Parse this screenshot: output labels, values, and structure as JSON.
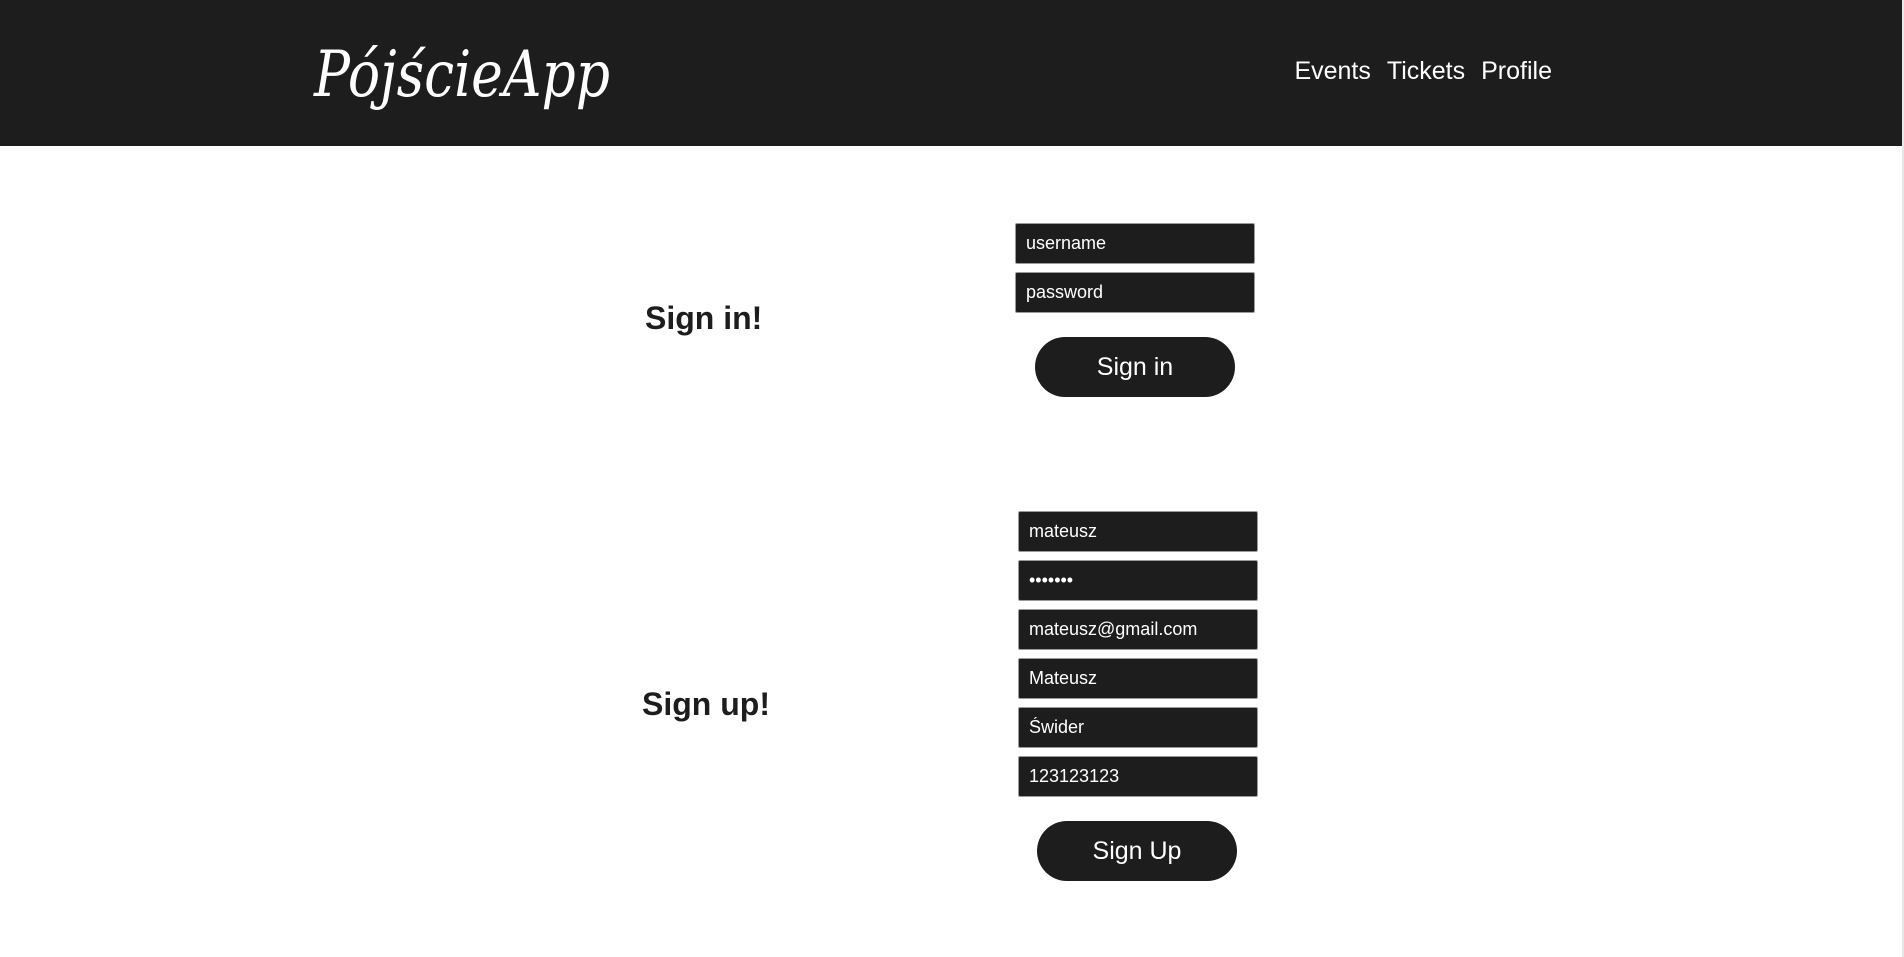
{
  "header": {
    "logo_text": "PójścieApp",
    "nav": [
      {
        "label": "Events"
      },
      {
        "label": "Tickets"
      },
      {
        "label": "Profile"
      }
    ]
  },
  "signin": {
    "heading": "Sign in!",
    "username": {
      "value": "",
      "placeholder": "username"
    },
    "password": {
      "value": "",
      "placeholder": "password"
    },
    "button_label": "Sign in"
  },
  "signup": {
    "heading": "Sign up!",
    "username_value": "mateusz",
    "password_value": "mateusz",
    "email_value": "mateusz@gmail.com",
    "first_name_value": "Mateusz",
    "last_name_value": "Świder",
    "phone_value": "123123123",
    "button_label": "Sign Up"
  },
  "colors": {
    "header_bg": "#1d1d1d",
    "field_bg": "#1d1d1d",
    "button_bg": "#1d1d1d",
    "text_light": "#ffffff",
    "text_dark": "#1d1d1d"
  }
}
